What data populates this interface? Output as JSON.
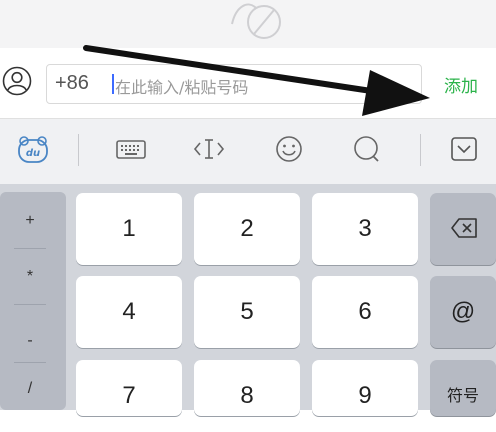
{
  "phone_input": {
    "country_code": "+86",
    "placeholder": "在此输入/粘贴号码"
  },
  "add_label": "添加",
  "toolbar": {
    "icons": [
      "du-emoji-icon",
      "keyboard-icon",
      "cursor-move-icon",
      "smiley-icon",
      "search-icon",
      "collapse-keyboard-icon"
    ]
  },
  "keyboard": {
    "side_symbols": [
      "+",
      "*",
      "-",
      "/"
    ],
    "keys": [
      "1",
      "2",
      "3",
      "4",
      "5",
      "6",
      "7",
      "8",
      "9"
    ],
    "delete_icon": "backspace-icon",
    "at_symbol": "@",
    "symbols_label": "符号"
  },
  "colors": {
    "add_green": "#2bb34a",
    "caret_blue": "#3d6bff",
    "keyboard_bg": "#d2d5db",
    "function_key": "#b6bac3"
  }
}
